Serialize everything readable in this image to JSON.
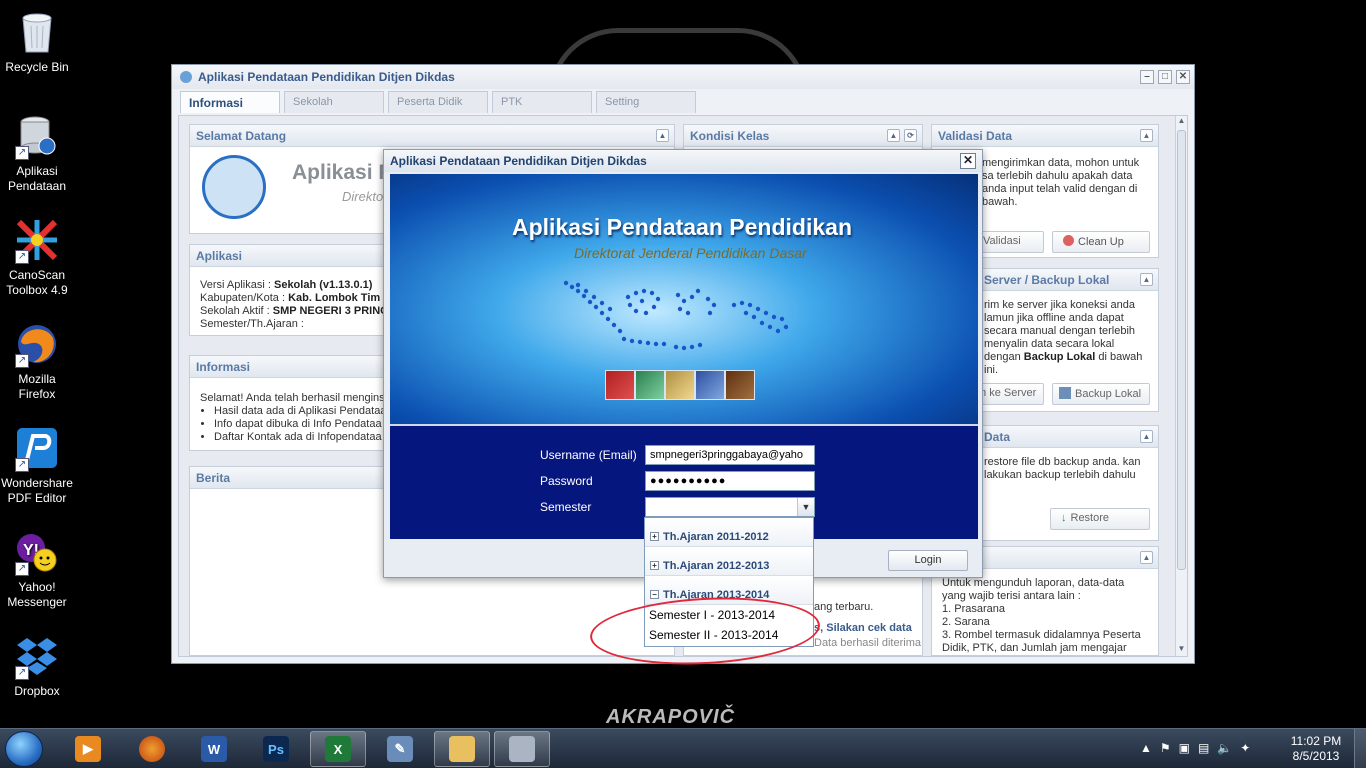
{
  "desktop": {
    "icons": [
      {
        "label": "Recycle Bin",
        "icon": "recycle-bin-icon"
      },
      {
        "label": "Aplikasi Pendataan",
        "icon": "database-app-icon"
      },
      {
        "label": "CanoScan Toolbox 4.9",
        "icon": "scanner-icon"
      },
      {
        "label": "Mozilla Firefox",
        "icon": "firefox-icon"
      },
      {
        "label": "Wondershare PDF Editor",
        "icon": "pdf-editor-icon"
      },
      {
        "label": "Yahoo! Messenger",
        "icon": "yahoo-messenger-icon"
      },
      {
        "label": "Dropbox",
        "icon": "dropbox-icon"
      }
    ],
    "wallpaper_logo": "AKRAPOVIČ"
  },
  "app": {
    "title": "Aplikasi Pendataan Pendidikan Ditjen Dikdas",
    "tabs": [
      "Informasi",
      "Sekolah",
      "Peserta Didik",
      "PTK",
      "Setting"
    ],
    "panels": {
      "selamat_datang": {
        "title": "Selamat Datang",
        "banner_text": "Aplikasi P",
        "banner_sub": "Direkto"
      },
      "aplikasi": {
        "title": "Aplikasi",
        "rows": [
          {
            "label": "Versi Aplikasi : ",
            "value": "Sekolah (v1.13.0.1)"
          },
          {
            "label": "Kabupaten/Kota : ",
            "value": "Kab. Lombok Tim"
          },
          {
            "label": "Sekolah Aktif : ",
            "value": "SMP NEGERI 3 PRING"
          },
          {
            "label": "Semester/Th.Ajaran :",
            "value": ""
          }
        ]
      },
      "informasi": {
        "title": "Informasi",
        "intro": "Selamat! Anda telah berhasil menginst",
        "bullets": [
          "Hasil data ada di Aplikasi Pendataa",
          "Info dapat dibuka di Info Pendataa",
          "Daftar Kontak ada di Infopendataa"
        ]
      },
      "berita": {
        "title": "Berita",
        "fragment1": "ang terbaru.",
        "fragment2": "s, Silakan cek data",
        "fragment3": "Data berhasil diterima dan diproses, be"
      },
      "kondisi_kelas": {
        "title": "Kondisi Kelas"
      },
      "validasi": {
        "title": "Validasi Data",
        "text": "mengirimkan data, mohon untuk sa terlebih dahulu apakah data anda input telah valid dengan di bawah.",
        "btn_validasi": "Validasi",
        "btn_cleanup": "Clean Up"
      },
      "server": {
        "title": "Server / Backup Lokal",
        "text": "rim ke server jika koneksi anda lamun jika offline anda dapat secara manual dengan terlebih menyalin data secara lokal dengan",
        "text_bold": "Backup Lokal",
        "text_end": " di bawah ini.",
        "btn_server": "m ke Server",
        "btn_backup": "Backup Lokal"
      },
      "restore": {
        "title": "Data",
        "text": "restore file db backup anda. kan lakukan backup terlebih dahulu",
        "btn_restore": "Restore"
      },
      "laporan": {
        "intro": "Untuk mengunduh laporan, data-data yang wajib terisi antara lain :",
        "items": [
          "1. Prasarana",
          "2. Sarana",
          "3. Rombel termasuk didalamnya Peserta Didik, PTK, dan Jumlah jam mengajar guru"
        ]
      }
    }
  },
  "login_dialog": {
    "title": "Aplikasi Pendataan Pendidikan Ditjen Dikdas",
    "banner_title": "Aplikasi Pendataan Pendidikan",
    "banner_subtitle": "Direktorat Jenderal Pendidikan Dasar",
    "username_label": "Username (Email)",
    "username_value": "smpnegeri3pringgabaya@yaho",
    "password_label": "Password",
    "password_value": "●●●●●●●●●●",
    "semester_label": "Semester",
    "semester_value": "",
    "login_button": "Login",
    "semester_options": {
      "groups": [
        {
          "label": "Th.Ajaran 2011-2012",
          "expanded": false
        },
        {
          "label": "Th.Ajaran 2012-2013",
          "expanded": false
        },
        {
          "label": "Th.Ajaran 2013-2014",
          "expanded": true
        }
      ],
      "items": [
        "Semester I - 2013-2014",
        "Semester II - 2013-2014"
      ]
    }
  },
  "taskbar": {
    "pinned": [
      {
        "name": "media-player",
        "icon": "media-player-icon"
      },
      {
        "name": "firefox",
        "icon": "firefox-icon"
      },
      {
        "name": "word",
        "icon": "word-icon"
      },
      {
        "name": "photoshop",
        "icon": "photoshop-icon"
      },
      {
        "name": "excel",
        "icon": "excel-icon"
      },
      {
        "name": "app",
        "icon": "app-icon"
      },
      {
        "name": "explorer",
        "icon": "folder-icon"
      },
      {
        "name": "pendataan",
        "icon": "database-app-icon"
      }
    ],
    "clock_time": "11:02 PM",
    "clock_date": "8/5/2013"
  },
  "colors": {
    "accent": "#2d4f7c",
    "dialog_form_bg": "#06167f",
    "annotation": "#e0283a"
  }
}
